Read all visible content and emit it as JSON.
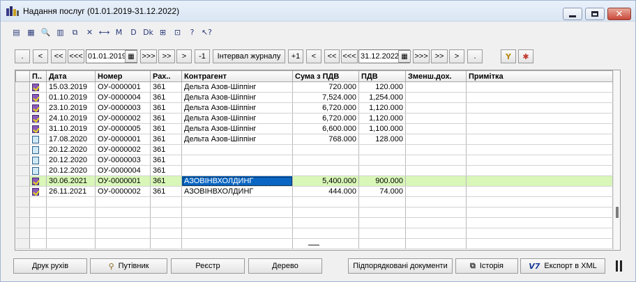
{
  "window": {
    "title": "Надання послуг (01.01.2019-31.12.2022)"
  },
  "toolbar_icons": [
    "add-doc-icon",
    "add-copy-icon",
    "find-icon",
    "edit-list-icon",
    "copy-icon",
    "delete-icon",
    "resize-columns-icon",
    "filter-icon",
    "posting-icon",
    "unpost-icon",
    "print-icon",
    "structure-icon",
    "help-icon",
    "help-pointer-icon"
  ],
  "toolbar_glyphs": [
    "▤",
    "▦",
    "🔍",
    "▥",
    "⧉",
    "✕",
    "⟷",
    "M",
    "D",
    "Dk",
    "⊞",
    "⊡",
    "?",
    "↖?"
  ],
  "nav": {
    "dot_left": ".",
    "prev": "<",
    "prev2": "<<",
    "prev3": "<<<",
    "start_date": "01.01.2019",
    "next3": ">>>",
    "next2": ">>",
    "next": ">",
    "minus1": "-1",
    "interval": "Інтервал журналу",
    "plus1": "+1",
    "prev_r": "<",
    "prev2_r": "<<",
    "prev3_r": "<<<",
    "end_date": "31.12.2022",
    "next3_r": ">>>",
    "next2_r": ">>",
    "next_r": ">",
    "dot_right": ".",
    "calendar_glyph": "▦",
    "filter_glyph": "Y",
    "unfilter_glyph": "✱"
  },
  "grid": {
    "columns": [
      "П..",
      "Дата",
      "Номер",
      "Рах..",
      "Контрагент",
      "Сума з ПДВ",
      "ПДВ",
      "Зменш.дох.",
      "Примітка"
    ],
    "rows": [
      {
        "state": "posted",
        "date": "15.03.2019",
        "number": "ОУ-0000001",
        "account": "361",
        "counterparty": "Дельта Азов-Шіппінг",
        "sum": "720.000",
        "vat": "120.000",
        "reduce": "",
        "note": ""
      },
      {
        "state": "posted",
        "date": "01.10.2019",
        "number": "ОУ-0000004",
        "account": "361",
        "counterparty": "Дельта Азов-Шіппінг",
        "sum": "7,524.000",
        "vat": "1,254.000",
        "reduce": "",
        "note": ""
      },
      {
        "state": "posted",
        "date": "23.10.2019",
        "number": "ОУ-0000003",
        "account": "361",
        "counterparty": "Дельта Азов-Шіппінг",
        "sum": "6,720.000",
        "vat": "1,120.000",
        "reduce": "",
        "note": ""
      },
      {
        "state": "posted",
        "date": "24.10.2019",
        "number": "ОУ-0000002",
        "account": "361",
        "counterparty": "Дельта Азов-Шіппінг",
        "sum": "6,720.000",
        "vat": "1,120.000",
        "reduce": "",
        "note": ""
      },
      {
        "state": "posted",
        "date": "31.10.2019",
        "number": "ОУ-0000005",
        "account": "361",
        "counterparty": "Дельта Азов-Шіппінг",
        "sum": "6,600.000",
        "vat": "1,100.000",
        "reduce": "",
        "note": ""
      },
      {
        "state": "draft",
        "date": "17.08.2020",
        "number": "ОУ-0000001",
        "account": "361",
        "counterparty": "Дельта Азов-Шіппінг",
        "sum": "768.000",
        "vat": "128.000",
        "reduce": "",
        "note": ""
      },
      {
        "state": "draft",
        "date": "20.12.2020",
        "number": "ОУ-0000002",
        "account": "361",
        "counterparty": "",
        "sum": "",
        "vat": "",
        "reduce": "",
        "note": ""
      },
      {
        "state": "draft",
        "date": "20.12.2020",
        "number": "ОУ-0000003",
        "account": "361",
        "counterparty": "",
        "sum": "",
        "vat": "",
        "reduce": "",
        "note": ""
      },
      {
        "state": "draft",
        "date": "20.12.2020",
        "number": "ОУ-0000004",
        "account": "361",
        "counterparty": "",
        "sum": "",
        "vat": "",
        "reduce": "",
        "note": ""
      },
      {
        "state": "posted",
        "date": "30.06.2021",
        "number": "ОУ-0000001",
        "account": "361",
        "counterparty": "АЗОВІНВХОЛДИНГ",
        "sum": "5,400.000",
        "vat": "900.000",
        "reduce": "",
        "note": "",
        "selected": true
      },
      {
        "state": "posted",
        "date": "26.11.2021",
        "number": "ОУ-0000002",
        "account": "361",
        "counterparty": "АЗОВІНВХОЛДИНГ",
        "sum": "444.000",
        "vat": "74.000",
        "reduce": "",
        "note": ""
      }
    ],
    "empty_rows": 5
  },
  "bottom": {
    "print_moves": "Друк рухів",
    "guide": "Путівник",
    "register": "Реєстр",
    "tree": "Дерево",
    "subordinate": "Підпорядковані документи",
    "history": "Історія",
    "export_xml": "Експорт в XML",
    "v7_glyph": "V7",
    "history_glyph": "⧉",
    "guide_glyph": "⚲"
  },
  "colors": {
    "selected_row": "#d9f7b8",
    "focus_cell": "#0a66c2"
  }
}
